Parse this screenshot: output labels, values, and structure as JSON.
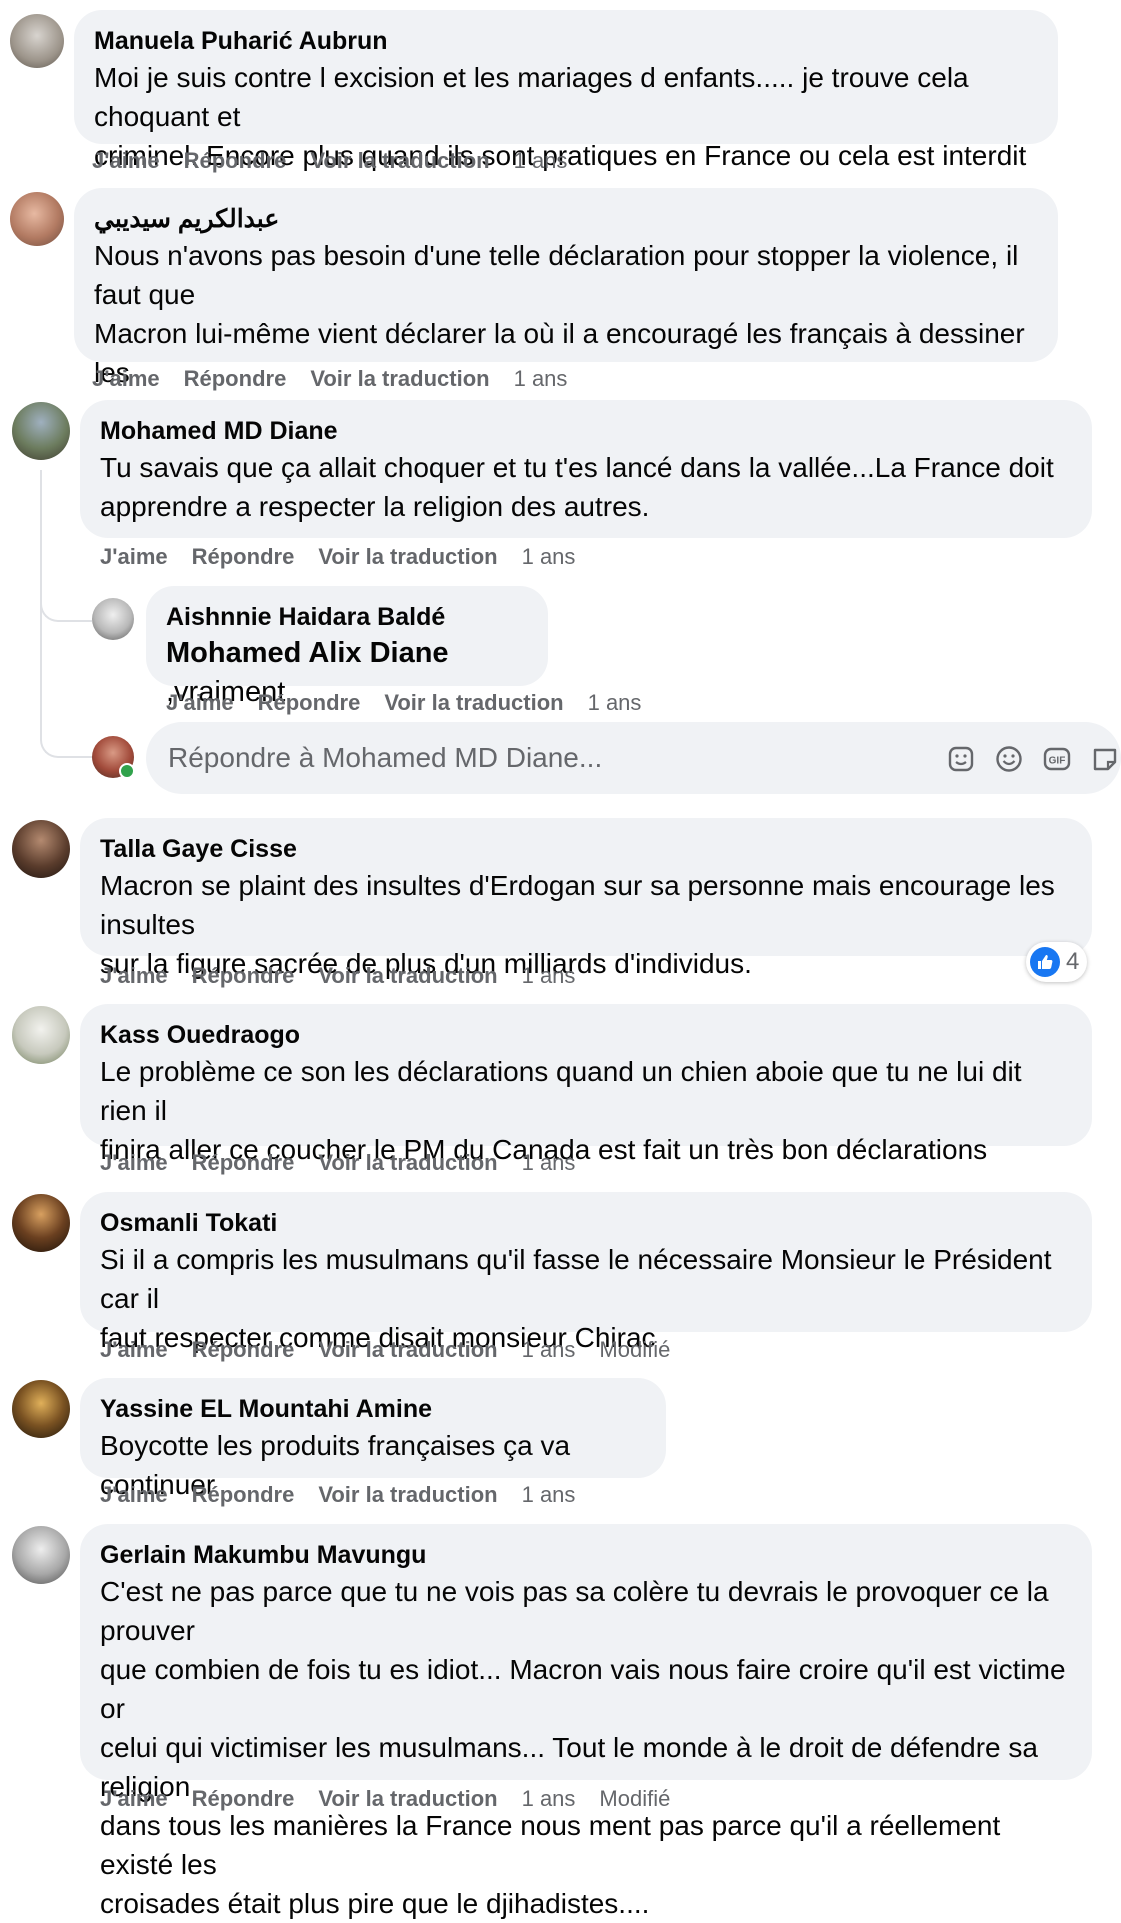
{
  "actions": {
    "like": "J'aime",
    "reply": "Répondre",
    "translate": "Voir la traduction",
    "edited": "Modifié"
  },
  "comments": [
    {
      "author": "Manuela Puharić Aubrun",
      "text": "Moi je suis contre l excision et les mariages d enfants..... je trouve cela choquant et\ncriminel. Encore plus quand ils sont pratiques en France ou cela est interdit .",
      "time": "1 ans"
    },
    {
      "author": "عبدالكريم سيديبي",
      "text": "Nous n'avons pas besoin d'une telle déclaration pour stopper la violence, il faut que\nMacron lui-même vient déclarer la où il a encouragé les français à dessiner les\ncaricatures",
      "time": "1 ans"
    },
    {
      "author": "Mohamed MD Diane",
      "text": "Tu savais que ça allait choquer et tu t'es lancé dans la vallée...La France doit\napprendre a respecter la religion des autres.",
      "time": "1 ans"
    },
    {
      "author": "Talla Gaye Cisse",
      "text": "Macron se plaint des insultes d'Erdogan sur sa personne mais encourage les insultes\nsur la figure sacrée de plus d'un milliards d'individus.",
      "time": "1 ans",
      "reactions": "4"
    },
    {
      "author": "Kass Ouedraogo",
      "text": "Le problème ce son les déclarations quand un chien aboie que tu ne lui dit rien il\nfinira aller ce coucher le PM du Canada est fait un très bon déclarations",
      "time": "1 ans"
    },
    {
      "author": "Osmanli Tokati",
      "text": "Si il a compris les musulmans qu'il fasse le nécessaire Monsieur le Président car il\nfaut respecter comme disait monsieur Chirac",
      "time": "1 ans"
    },
    {
      "author": "Yassine EL Mountahi Amine",
      "text": "Boycotte les produits françaises ça va continuer",
      "time": "1 ans"
    },
    {
      "author": "Gerlain Makumbu Mavungu",
      "text": "C'est ne pas parce que tu ne vois pas sa colère tu devrais le provoquer ce la prouver\nque combien de fois tu es idiot... Macron vais nous faire croire qu'il est victime or\ncelui qui victimiser les musulmans... Tout le monde à le droit de défendre sa religion\ndans tous les manières la France nous ment pas parce qu'il a réellement existé les\ncroisades était plus pire que le djihadistes....",
      "time": "1 ans"
    }
  ],
  "reply": {
    "author": "Aishnnie Haidara Baldé",
    "mention": "Mohamed Alix Diane",
    "text": " ,vraiment",
    "time": "1 ans"
  },
  "reply_input": {
    "placeholder": "Répondre à Mohamed MD Diane...",
    "icons": [
      "sticker-icon",
      "emoji-icon",
      "gif-icon",
      "sticker-face-icon"
    ]
  },
  "colors": {
    "bubble": "#f0f2f5",
    "secondary_text": "#65676b",
    "like_blue": "#1877f2",
    "online_green": "#31a24c"
  }
}
